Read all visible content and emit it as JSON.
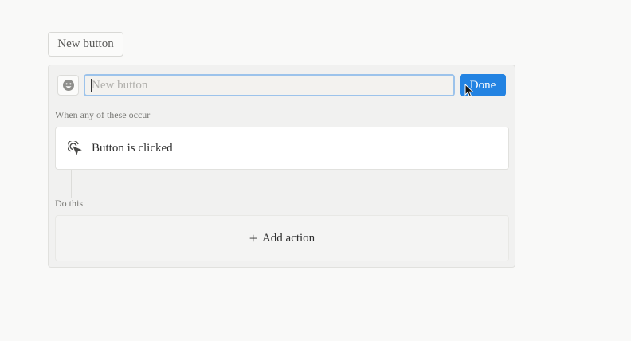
{
  "top_button": {
    "label": "New button"
  },
  "editor": {
    "emoji_icon": "smiley-face-icon",
    "name_placeholder": "New button",
    "name_value": "",
    "done_label": "Done"
  },
  "triggers": {
    "label": "When any of these occur",
    "item": {
      "icon": "pointer-click-icon",
      "label": "Button is clicked"
    }
  },
  "actions": {
    "label": "Do this",
    "add_icon": "plus-icon",
    "add_label": "Add action"
  },
  "colors": {
    "accent": "#2383e2",
    "input_focus_border": "#9cc3eb",
    "panel_bg": "#f1f1f0"
  }
}
